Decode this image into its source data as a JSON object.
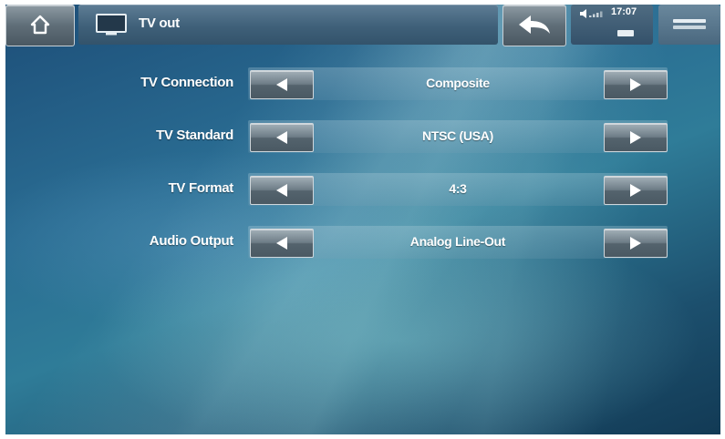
{
  "header": {
    "title": "TV out",
    "clock": "17:07"
  },
  "icons": {
    "home": "home-icon",
    "tv": "tv-icon",
    "back": "back-arrow-icon",
    "volume": "volume-icon",
    "battery": "battery-icon",
    "menu": "menu-icon"
  },
  "settings": [
    {
      "label": "TV Connection",
      "value": "Composite"
    },
    {
      "label": "TV Standard",
      "value": "NTSC (USA)"
    },
    {
      "label": "TV Format",
      "value": "4:3"
    },
    {
      "label": "Audio Output",
      "value": "Analog Line-Out"
    }
  ],
  "colors": {
    "background": "#2a6d93",
    "text": "#ffffff",
    "button": "#6d7c86"
  }
}
